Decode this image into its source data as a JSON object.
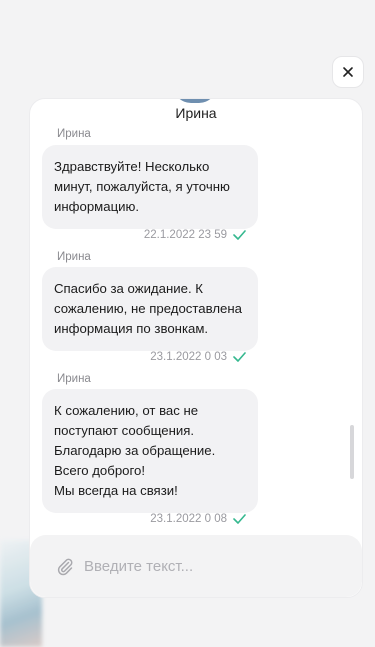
{
  "agent": {
    "name": "Ирина"
  },
  "messages": [
    {
      "sender": "Ирина",
      "text": "Здравствуйте! Несколько\nминут, пожалуйста, я уточню\nинформацию.",
      "timestamp": "22.1.2022 23 59"
    },
    {
      "sender": "Ирина",
      "text": "Спасибо за ожидание. К\nсожалению, не предоставлена\nинформация по звонкам.",
      "timestamp": "23.1.2022 0 03"
    },
    {
      "sender": "Ирина",
      "text": "К сожалению, от вас не\nпоступают сообщения.\nБлагодарю за обращение.\nВсего доброго!\nМы всегда на связи!",
      "timestamp": "23.1.2022 0 08"
    }
  ],
  "composer": {
    "placeholder": "Введите текст..."
  },
  "icons": {
    "close": "close-icon",
    "attach": "paperclip-icon",
    "read": "check-icon"
  },
  "colors": {
    "check": "#35b88f",
    "bubble": "#f2f2f4"
  }
}
